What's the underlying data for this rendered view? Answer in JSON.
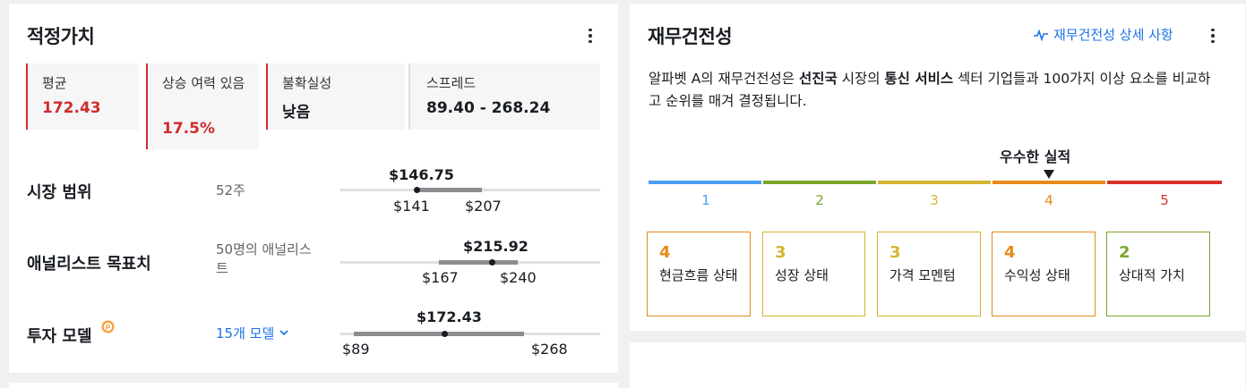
{
  "fair_value": {
    "title": "적정가치",
    "metrics": [
      {
        "label": "평균",
        "value": "172.43",
        "value_color": "#d12b2b"
      },
      {
        "label": "상승 여력 있음",
        "value": "17.5%",
        "value_color": "#d12b2b"
      },
      {
        "label": "불확실성",
        "value": "낮음"
      },
      {
        "label": "스프레드",
        "value": "89.40 - 268.24"
      }
    ],
    "rows": [
      {
        "title": "시장 범위",
        "sub": "52주",
        "top": "$146.75",
        "low": "$141",
        "high": "$207",
        "marker_fraction": 0.09
      },
      {
        "title": "애널리스트 목표치",
        "sub": "50명의 애널리스트",
        "top": "$215.92",
        "low": "$167",
        "high": "$240",
        "marker_fraction": 0.67
      },
      {
        "title": "투자 모델",
        "sub": "15개 모델",
        "top": "$172.43",
        "low": "$89",
        "high": "$268",
        "marker_fraction": 0.47
      }
    ]
  },
  "health": {
    "title": "재무건전성",
    "detail_link": "재무건전성 상세 사항",
    "desc_parts": [
      "알파벳 A의 재무건전성은 ",
      "선진국",
      " 시장의 ",
      "통신 서비스",
      " 섹터 기업들과 100가지 이상 요소를 비교하고 순위를 매겨 결정됩니다."
    ],
    "performance_label": "우수한 실적",
    "current_level": 4,
    "scale": [
      {
        "num": "1",
        "color": "#4a9ef0"
      },
      {
        "num": "2",
        "color": "#7aa62a"
      },
      {
        "num": "3",
        "color": "#d6b530"
      },
      {
        "num": "4",
        "color": "#e68a1a"
      },
      {
        "num": "5",
        "color": "#d9302b"
      }
    ],
    "scores": [
      {
        "score": "4",
        "label": "현금흐름 상태",
        "color": "#e68a1a"
      },
      {
        "score": "3",
        "label": "성장 상태",
        "color": "#d6b530"
      },
      {
        "score": "3",
        "label": "가격 모멘텀",
        "color": "#d6b530"
      },
      {
        "score": "4",
        "label": "수익성 상태",
        "color": "#e68a1a"
      },
      {
        "score": "2",
        "label": "상대적 가치",
        "color": "#7aa62a"
      }
    ]
  }
}
